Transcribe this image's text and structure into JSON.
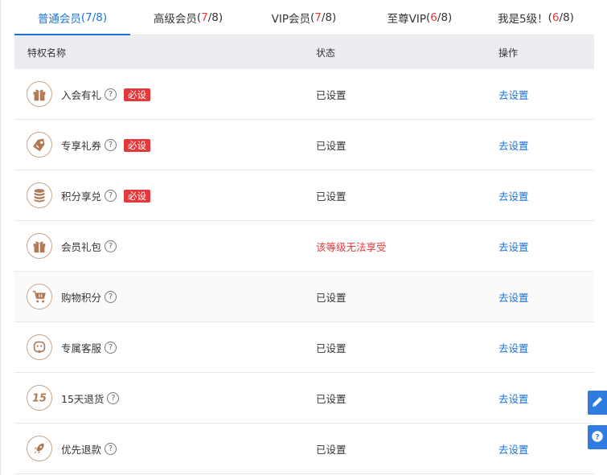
{
  "tabs": [
    {
      "label": "普通会员",
      "open": "(",
      "current": "7",
      "sep": "/",
      "total": "8",
      "close": ")",
      "active": true
    },
    {
      "label": "高级会员",
      "open": "(",
      "current": "7",
      "sep": "/",
      "total": "8",
      "close": ")",
      "active": false
    },
    {
      "label": "VIP会员",
      "open": "(",
      "current": "7",
      "sep": "/",
      "total": "8",
      "close": ")",
      "active": false
    },
    {
      "label": "至尊VIP",
      "open": "(",
      "current": "6",
      "sep": "/",
      "total": "8",
      "close": ")",
      "active": false
    },
    {
      "label": "我是5级！",
      "open": "(",
      "current": "6",
      "sep": "/",
      "total": "8",
      "close": ")",
      "active": false
    }
  ],
  "table": {
    "headers": {
      "name": "特权名称",
      "status": "状态",
      "action": "操作"
    },
    "rows": [
      {
        "icon": "gift-icon",
        "name": "入会有礼",
        "required": "必设",
        "status": "已设置",
        "action": "去设置"
      },
      {
        "icon": "tag-icon",
        "name": "专享礼券",
        "required": "必设",
        "status": "已设置",
        "action": "去设置"
      },
      {
        "icon": "coin-stack-icon",
        "name": "积分享兑",
        "required": "必设",
        "status": "已设置",
        "action": "去设置"
      },
      {
        "icon": "gift-icon",
        "name": "会员礼包",
        "required": "",
        "status": "该等级无法享受",
        "status_warn": true,
        "action": "去设置"
      },
      {
        "icon": "cart-icon",
        "name": "购物积分",
        "required": "",
        "status": "已设置",
        "action": "去设置"
      },
      {
        "icon": "service-icon",
        "name": "专属客服",
        "required": "",
        "status": "已设置",
        "action": "去设置"
      },
      {
        "icon": "fifteen-days-icon",
        "name": "15天退货",
        "required": "",
        "status": "已设置",
        "action": "去设置"
      },
      {
        "icon": "rocket-icon",
        "name": "优先退款",
        "required": "",
        "status": "已设置",
        "action": "去设置"
      }
    ]
  },
  "help_glyph": "?",
  "badge_15": "15",
  "colors": {
    "accent": "#1a73d9",
    "danger": "#e4393c",
    "icon": "#b07a55",
    "header_bg": "#ebedf0"
  },
  "float_buttons": [
    "edit-icon",
    "help-icon"
  ]
}
